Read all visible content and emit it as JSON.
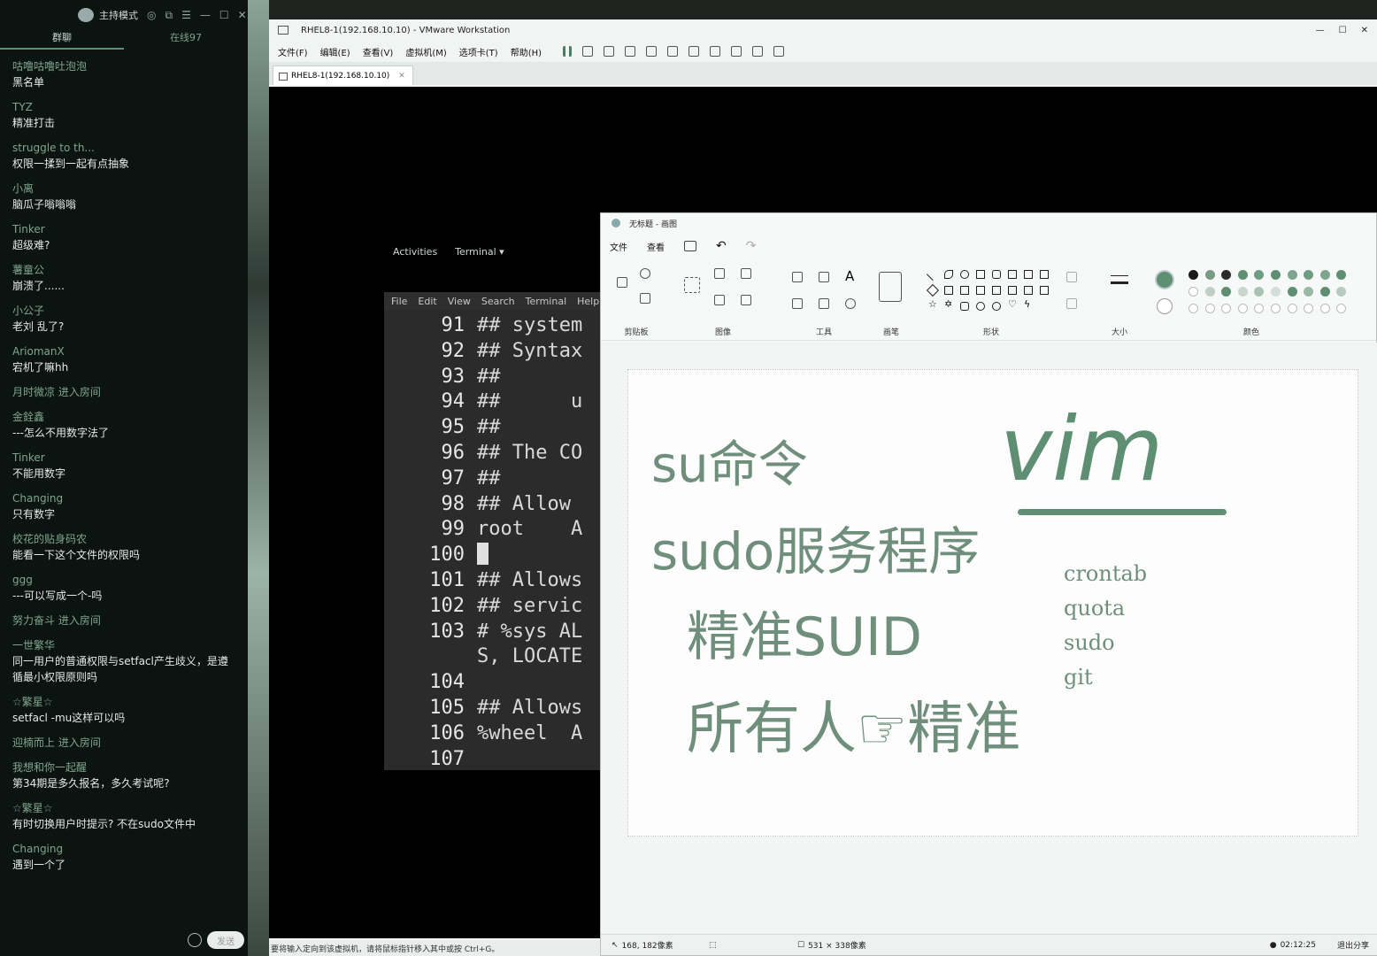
{
  "chat": {
    "host_mode": "主持模式",
    "tabs": [
      "群聊",
      "在线97"
    ],
    "messages": [
      {
        "user": "咕噜咕噜吐泡泡",
        "text": "黑名单"
      },
      {
        "user": "TYZ",
        "text": "精准打击"
      },
      {
        "user": "struggle to th...",
        "text": "权限一揉到一起有点抽象"
      },
      {
        "user": "小离",
        "text": "脑瓜子嗡嗡嗡"
      },
      {
        "user": "Tinker",
        "text": "超级难?"
      },
      {
        "user": "薯童公",
        "text": "崩溃了......"
      },
      {
        "user": "小公子",
        "text": "老刘 乱了?"
      },
      {
        "user": "AriomanX",
        "text": "宕机了嘛hh"
      },
      {
        "user": "月时微凉 进入房间",
        "text": ""
      },
      {
        "user": "金銓鑫",
        "text": "---怎么不用数字法了"
      },
      {
        "user": "Tinker",
        "text": "不能用数字"
      },
      {
        "user": "Changing",
        "text": "只有数字"
      },
      {
        "user": "校花的贴身码农",
        "text": "能看一下这个文件的权限吗"
      },
      {
        "user": "ggg",
        "text": "---可以写成一个-吗"
      },
      {
        "user": "努力奋斗 进入房间",
        "text": ""
      },
      {
        "user": "一世繁华",
        "text": "同一用户的普通权限与setfacl产生歧义，是遵循最小权限原则吗"
      },
      {
        "user": "☆繁星☆",
        "text": "setfacl  -mu这样可以吗"
      },
      {
        "user": "迎楠而上 进入房间",
        "text": ""
      },
      {
        "user": "我想和你一起醒",
        "text": "第34期是多久报名，多久考试呢?"
      },
      {
        "user": "☆繁星☆",
        "text": "有时切换用户时提示? 不在sudo文件中"
      },
      {
        "user": "Changing",
        "text": "遇到一个了"
      }
    ],
    "send_label": "发送"
  },
  "vmware": {
    "title": "RHEL8-1(192.168.10.10) - VMware Workstation",
    "menu": [
      "文件(F)",
      "编辑(E)",
      "查看(V)",
      "虚拟机(M)",
      "选项卡(T)",
      "帮助(H)"
    ],
    "tab": "RHEL8-1(192.168.10.10)",
    "status": "要将输入定向到该虚拟机，请将鼠标指针移入其中或按 Ctrl+G。"
  },
  "gnome": {
    "activities": "Activities",
    "terminal": "Terminal ▾"
  },
  "terminal": {
    "menu": [
      "File",
      "Edit",
      "View",
      "Search",
      "Terminal",
      "Help"
    ],
    "lines": [
      {
        "no": "91",
        "text": "## system"
      },
      {
        "no": "92",
        "text": "## Syntax"
      },
      {
        "no": "93",
        "text": "##"
      },
      {
        "no": "94",
        "text": "##      u"
      },
      {
        "no": "95",
        "text": "##"
      },
      {
        "no": "96",
        "text": "## The CO"
      },
      {
        "no": "97",
        "text": "##"
      },
      {
        "no": "98",
        "text": "## Allow"
      },
      {
        "no": "99",
        "text": "root    A"
      },
      {
        "no": "100",
        "text": ""
      },
      {
        "no": "101",
        "text": "## Allows"
      },
      {
        "no": "102",
        "text": "## servic"
      },
      {
        "no": "103",
        "text": "# %sys AL"
      },
      {
        "no": "",
        "text": "S, LOCATE"
      },
      {
        "no": "104",
        "text": ""
      },
      {
        "no": "105",
        "text": "## Allows"
      },
      {
        "no": "106",
        "text": "%wheel  A"
      },
      {
        "no": "107",
        "text": ""
      }
    ]
  },
  "paint": {
    "title": "无标题 - 画图",
    "menu": [
      "文件",
      "查看"
    ],
    "groups": [
      "剪贴板",
      "图像",
      "工具",
      "画笔",
      "形状",
      "大小",
      "颜色"
    ],
    "status_pos": "168, 182像素",
    "status_size": "531 × 338像素",
    "canvas_text": {
      "su": "su命令",
      "vim": "vim",
      "sudo": "sudo服务程序",
      "suid": "精准SUID",
      "all": "所有人☞精准",
      "list": [
        "crontab",
        "quota",
        "sudo",
        "git"
      ]
    },
    "accent": "#5e8f72"
  },
  "taskbar": {
    "time": "02:12:25",
    "exit_share": "退出分享"
  }
}
